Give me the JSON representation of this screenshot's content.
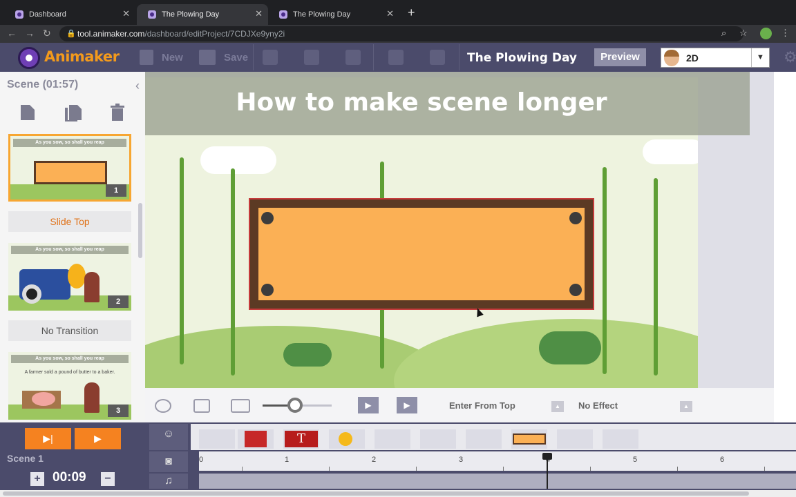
{
  "browser": {
    "tabs": [
      {
        "label": "Dashboard",
        "active": false
      },
      {
        "label": "The Plowing Day",
        "active": true
      },
      {
        "label": "The Plowing Day",
        "active": false
      }
    ],
    "url_host": "tool.animaker.com",
    "url_path": "/dashboard/editProject/7CDJXe9yny2i"
  },
  "app": {
    "logo_text": "Animaker",
    "toolbar": {
      "new_label": "New",
      "save_label": "Save"
    },
    "project_title": "The Plowing Day",
    "preview_label": "Preview",
    "mode_select": {
      "value": "2D"
    }
  },
  "scene_panel": {
    "header": "Scene  (01:57)",
    "scenes": [
      {
        "caption": "As you sow, so shall you reap",
        "number": "1",
        "transition": "Slide Top"
      },
      {
        "caption": "As you sow, so shall you reap",
        "number": "2",
        "transition": "No Transition"
      },
      {
        "caption": "As you sow, so shall you reap",
        "subcaption": "A farmer sold a pound of butter to a baker.",
        "number": "3"
      }
    ]
  },
  "canvas": {
    "title": "How to make scene longer"
  },
  "controls": {
    "enter_effect": "Enter From Top",
    "exit_effect": "No Effect"
  },
  "bottom": {
    "scene_label": "Scene  1",
    "duration": "00:09",
    "plus": "+",
    "minus": "−",
    "ruler_labels": [
      "0",
      "1",
      "2",
      "3",
      "4",
      "5",
      "6"
    ],
    "text_item": "T"
  },
  "colors": {
    "accent_orange": "#f58220",
    "toolbar_bg": "#4b4b6b",
    "sign_fill": "#fbb055"
  }
}
